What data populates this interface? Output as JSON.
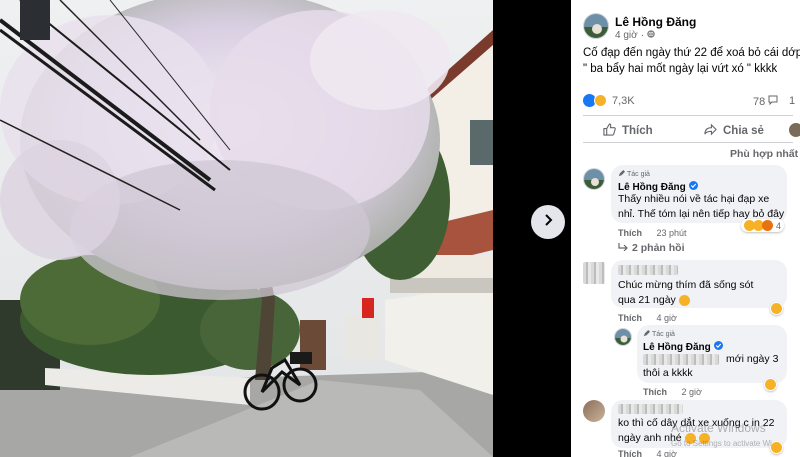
{
  "post": {
    "author": "Lê Hồng Đăng",
    "time": "4 giờ",
    "privacy_icon": "globe-icon",
    "caption": "Cố đạp đến ngày thứ 22 để xoá bỏ cái dớp \" ba bẩy hai mốt ngày lại vứt xó \" kkkk",
    "reaction_count": "7,3K",
    "comment_count": "78",
    "share_count_partial": "1",
    "like_label": "Thích",
    "share_label": "Chia sẻ",
    "sort_label": "Phù hợp nhất"
  },
  "comments": [
    {
      "badge": "Tác giả",
      "author": "Lê Hồng Đăng",
      "text": "Thấy nhiều nói về tác hại đạp xe nhỉ. Thế tóm lại nên tiếp hay bỏ đây",
      "like": "Thích",
      "time": "23 phút",
      "reaction_count": "4",
      "replies_label": "2 phản hồi"
    },
    {
      "text": "Chúc mừng thím đã sống sót qua 21 ngày",
      "like": "Thích",
      "time": "4 giờ"
    },
    {
      "badge": "Tác giả",
      "author": "Lê Hồng Đăng",
      "text_tail": "mới ngày 3",
      "text_line2": "thôi a kkkk",
      "like": "Thích",
      "time": "2 giờ"
    },
    {
      "text": "ko thì cố dây dắt xe xuống c in 22 ngày anh nhé",
      "like": "Thích",
      "time": "4 giờ"
    }
  ],
  "watermark": {
    "title": "Activate Windows",
    "subtitle": "Go to Settings to activate Wi"
  },
  "colors": {
    "facebook_blue": "#1877f2",
    "text_primary": "#050505",
    "text_secondary": "#65676b",
    "bubble_bg": "#f0f2f5"
  }
}
